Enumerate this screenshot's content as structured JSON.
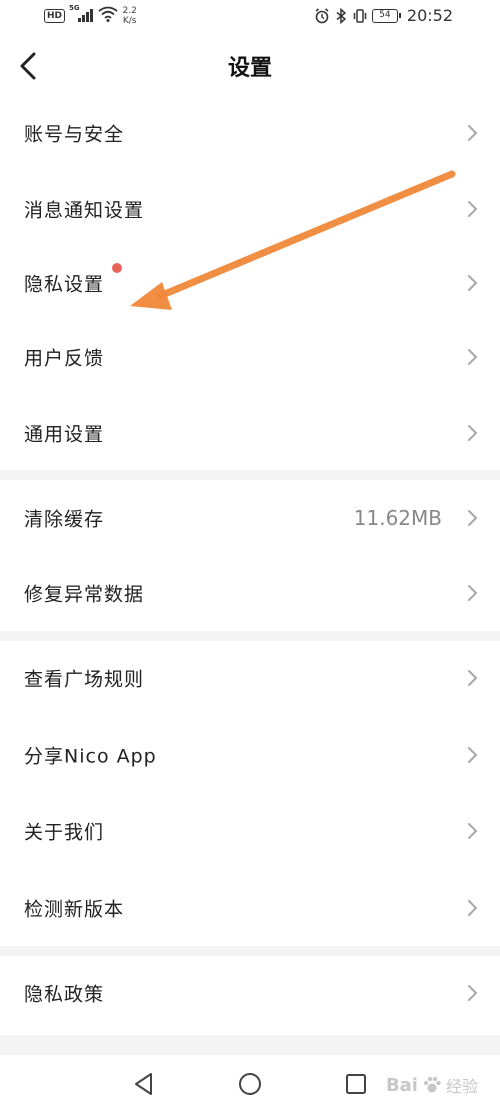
{
  "statusbar": {
    "network_speed_value": "2.2",
    "network_speed_unit": "K/s",
    "battery": "54",
    "time": "20:52"
  },
  "header": {
    "title": "设置"
  },
  "groups": [
    {
      "items": [
        {
          "label": "账号与安全"
        },
        {
          "label": "消息通知设置"
        },
        {
          "label": "隐私设置",
          "badge_dot": true
        },
        {
          "label": "用户反馈"
        },
        {
          "label": "通用设置"
        }
      ]
    },
    {
      "items": [
        {
          "label": "清除缓存",
          "value": "11.62MB"
        },
        {
          "label": "修复异常数据"
        }
      ]
    },
    {
      "items": [
        {
          "label": "查看广场规则"
        },
        {
          "label": "分享Nico App"
        },
        {
          "label": "关于我们"
        },
        {
          "label": "检测新版本"
        }
      ]
    },
    {
      "items": [
        {
          "label": "隐私政策"
        }
      ]
    }
  ],
  "colors": {
    "accent_arrow": "#f0883a",
    "badge_dot": "#e8645a",
    "divider": "#f4f4f4"
  },
  "watermark": {
    "logo_text": "Bai",
    "sub_text": "经验"
  }
}
